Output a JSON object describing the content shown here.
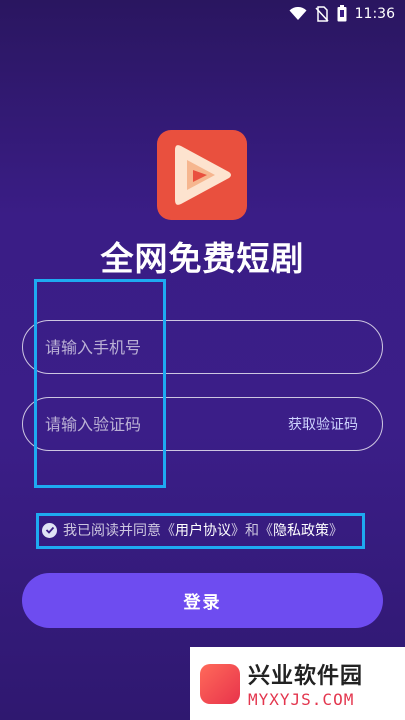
{
  "status_bar": {
    "time": "11:36"
  },
  "app": {
    "title": "全网免费短剧"
  },
  "form": {
    "phone_placeholder": "请输入手机号",
    "code_placeholder": "请输入验证码",
    "get_code_label": "获取验证码"
  },
  "agreement": {
    "prefix": "我已阅读并同意《",
    "user_agreement": "用户协议",
    "middle": "》和《",
    "privacy_policy": "隐私政策",
    "suffix": "》",
    "checked": true
  },
  "login_label": "登录",
  "watermark": {
    "title": "兴业软件园",
    "url": "MYXYJS.COM"
  },
  "colors": {
    "button": "#6e4cf0",
    "logo": "#e9503e",
    "highlight": "#1eaaf1"
  },
  "icons": [
    "wifi-icon",
    "no-sim-icon",
    "battery-icon",
    "play-logo-icon",
    "check-icon"
  ]
}
